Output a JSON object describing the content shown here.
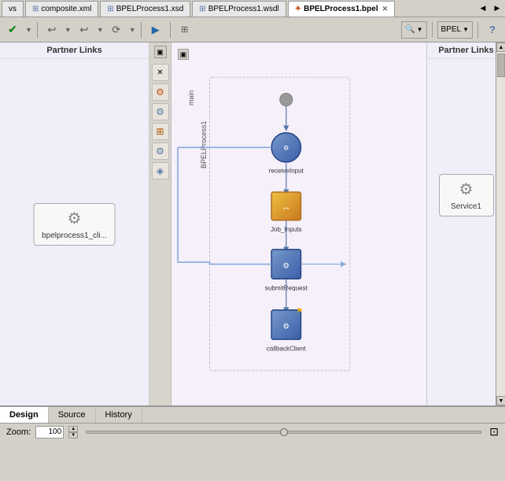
{
  "tabs": [
    {
      "id": "composite",
      "label": "composite.xml",
      "active": false,
      "closeable": false,
      "icon": "grid-icon"
    },
    {
      "id": "bpelxsd",
      "label": "BPELProcess1.xsd",
      "active": false,
      "closeable": false,
      "icon": "grid-icon"
    },
    {
      "id": "bpelwsdl",
      "label": "BPELProcess1.wsdl",
      "active": false,
      "closeable": false,
      "icon": "grid-icon"
    },
    {
      "id": "bpelbpel",
      "label": "BPELProcess1.bpel",
      "active": true,
      "closeable": true,
      "icon": "bpel-icon"
    }
  ],
  "toolbar": {
    "save_label": "✔",
    "undo_label": "↩",
    "redo_label": "↪",
    "refresh_label": "⟳",
    "run_label": "▶",
    "search_placeholder": "",
    "bpel_dropdown": "BPEL",
    "help_label": "?"
  },
  "left_panel": {
    "title": "Partner Links",
    "partner_link": {
      "label": "bpelprocess1_cli...",
      "icon": "gear-icon"
    }
  },
  "right_panel": {
    "title": "Partner Links",
    "partner_link": {
      "label": "Service1",
      "icon": "gear-icon"
    }
  },
  "canvas": {
    "labels": {
      "main": "main",
      "process": "BPELProcess1"
    },
    "nodes": [
      {
        "id": "start",
        "type": "start",
        "label": ""
      },
      {
        "id": "receiveInput",
        "type": "receive",
        "label": "receiveInput"
      },
      {
        "id": "job_inputs",
        "type": "assign",
        "label": "Job_Inputs"
      },
      {
        "id": "submitRequest",
        "type": "invoke",
        "label": "submitRequest",
        "flag": true
      },
      {
        "id": "callbackClient",
        "type": "invoke",
        "label": "callbackClient",
        "flag": true
      }
    ]
  },
  "bottom_tabs": [
    {
      "id": "design",
      "label": "Design",
      "active": true
    },
    {
      "id": "source",
      "label": "Source",
      "active": false
    },
    {
      "id": "history",
      "label": "History",
      "active": false
    }
  ],
  "zoom": {
    "label": "Zoom:",
    "value": "100",
    "unit": ""
  },
  "palette_items": [
    "□",
    "☆",
    "⊕",
    "◎",
    "❖",
    "◈"
  ]
}
